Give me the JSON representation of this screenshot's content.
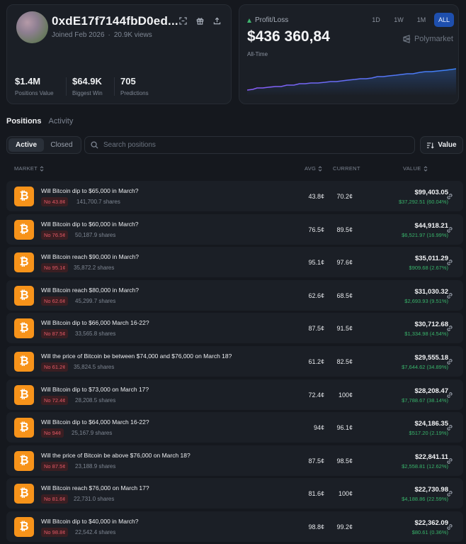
{
  "profile": {
    "username": "0xdE17f7144fbD0ed...",
    "joined": "Joined Feb 2026",
    "views": "20.9K views",
    "stats": [
      {
        "value": "$1.4M",
        "label": "Positions Value"
      },
      {
        "value": "$64.9K",
        "label": "Biggest Win"
      },
      {
        "value": "705",
        "label": "Predictions"
      }
    ]
  },
  "pnl": {
    "label": "Profit/Loss",
    "value": "$436 360,84",
    "period": "All-Time",
    "ranges": [
      "1D",
      "1W",
      "1M",
      "ALL"
    ],
    "active_range": "ALL",
    "brand": "Polymarket",
    "line_colors": [
      "#8a5cf6",
      "#3b82f6"
    ]
  },
  "tabs": {
    "positions": "Positions",
    "activity": "Activity"
  },
  "filters": {
    "active": "Active",
    "closed": "Closed"
  },
  "search": {
    "placeholder": "Search positions"
  },
  "sort": {
    "label": "Value"
  },
  "columns": {
    "market": "MARKET",
    "avg": "AVG",
    "current": "CURRENT",
    "value": "VALUE"
  },
  "positions": [
    {
      "title": "Will Bitcoin dip to $65,000 in March?",
      "badge": "No 43.8¢",
      "shares": "141,700.7 shares",
      "avg": "43.8¢",
      "current": "70.2¢",
      "value": "$99,403.05",
      "gain": "$37,292.51 (60.04%)"
    },
    {
      "title": "Will Bitcoin dip to $60,000 in March?",
      "badge": "No 76.5¢",
      "shares": "50,187.9 shares",
      "avg": "76.5¢",
      "current": "89.5¢",
      "value": "$44,918.21",
      "gain": "$6,521.97 (16.99%)"
    },
    {
      "title": "Will Bitcoin reach $90,000 in March?",
      "badge": "No 95.1¢",
      "shares": "35,872.2 shares",
      "avg": "95.1¢",
      "current": "97.6¢",
      "value": "$35,011.29",
      "gain": "$909.68 (2.67%)"
    },
    {
      "title": "Will Bitcoin reach $80,000 in March?",
      "badge": "No 62.6¢",
      "shares": "45,299.7 shares",
      "avg": "62.6¢",
      "current": "68.5¢",
      "value": "$31,030.32",
      "gain": "$2,693.93 (9.51%)"
    },
    {
      "title": "Will Bitcoin dip to $66,000 March 16-22?",
      "badge": "No 87.5¢",
      "shares": "33,565.8 shares",
      "avg": "87.5¢",
      "current": "91.5¢",
      "value": "$30,712.68",
      "gain": "$1,334.98 (4.54%)"
    },
    {
      "title": "Will the price of Bitcoin be between $74,000 and $76,000 on March 18?",
      "badge": "No 61.2¢",
      "shares": "35,824.5 shares",
      "avg": "61.2¢",
      "current": "82.5¢",
      "value": "$29,555.18",
      "gain": "$7,644.62 (34.89%)"
    },
    {
      "title": "Will Bitcoin dip to $73,000 on March 17?",
      "badge": "No 72.4¢",
      "shares": "28,208.5 shares",
      "avg": "72.4¢",
      "current": "100¢",
      "value": "$28,208.47",
      "gain": "$7,788.67 (38.14%)"
    },
    {
      "title": "Will Bitcoin dip to $64,000 March 16-22?",
      "badge": "No 94¢",
      "shares": "25,167.9 shares",
      "avg": "94¢",
      "current": "96.1¢",
      "value": "$24,186.35",
      "gain": "$517.20 (2.19%)"
    },
    {
      "title": "Will the price of Bitcoin be above $76,000 on March 18?",
      "badge": "No 87.5¢",
      "shares": "23,188.9 shares",
      "avg": "87.5¢",
      "current": "98.5¢",
      "value": "$22,841.11",
      "gain": "$2,558.81 (12.62%)"
    },
    {
      "title": "Will Bitcoin reach $76,000 on March 17?",
      "badge": "No 81.6¢",
      "shares": "22,731.0 shares",
      "avg": "81.6¢",
      "current": "100¢",
      "value": "$22,730.98",
      "gain": "$4,188.86 (22.59%)"
    },
    {
      "title": "Will Bitcoin dip to $40,000 in March?",
      "badge": "No 98.8¢",
      "shares": "22,542.4 shares",
      "avg": "98.8¢",
      "current": "99.2¢",
      "value": "$22,362.09",
      "gain": "$80.61 (0.36%)"
    }
  ],
  "colors": {
    "accent": "#1e4fae",
    "gain": "#38b36a",
    "loss": "#e35865",
    "bitcoin": "#f7931a"
  }
}
